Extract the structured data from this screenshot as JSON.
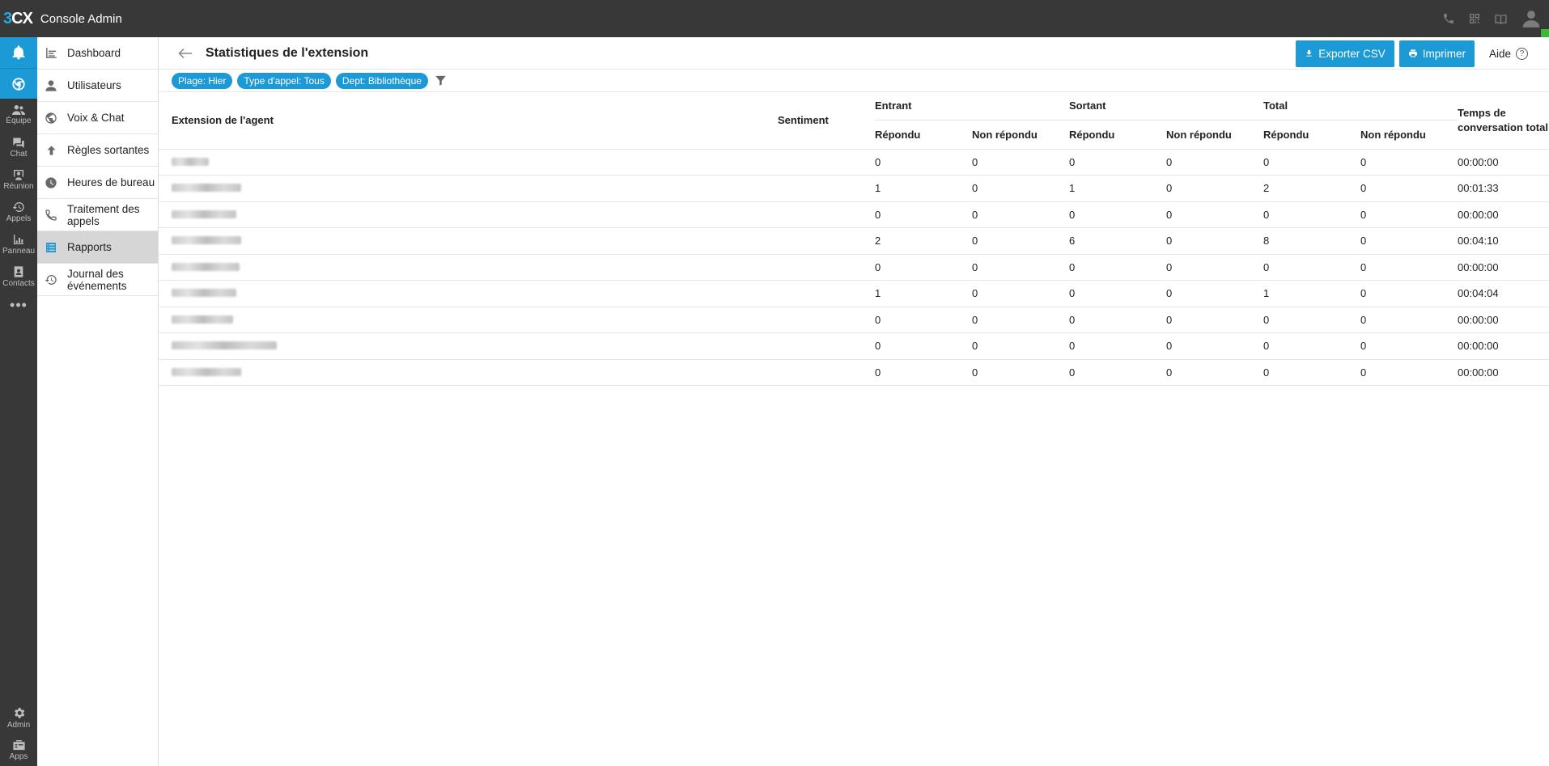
{
  "app": {
    "logo_accent": "3",
    "logo_rest": "CX",
    "title": "Console Admin"
  },
  "rail": {
    "items": [
      {
        "label": "Équipe",
        "icon": "team-icon"
      },
      {
        "label": "Chat",
        "icon": "chat-icon"
      },
      {
        "label": "Réunion",
        "icon": "meeting-icon"
      },
      {
        "label": "Appels",
        "icon": "calls-history-icon"
      },
      {
        "label": "Panneau",
        "icon": "panel-icon"
      },
      {
        "label": "Contacts",
        "icon": "contacts-icon"
      }
    ],
    "more": "•••",
    "bottom": [
      {
        "label": "Admin",
        "icon": "gear-icon"
      },
      {
        "label": "Apps",
        "icon": "apps-icon"
      }
    ]
  },
  "sidebar": {
    "items": [
      {
        "label": "Dashboard",
        "icon": "dashboard-icon"
      },
      {
        "label": "Utilisateurs",
        "icon": "user-icon"
      },
      {
        "label": "Voix & Chat",
        "icon": "globe-icon"
      },
      {
        "label": "Règles sortantes",
        "icon": "arrow-up-icon"
      },
      {
        "label": "Heures de bureau",
        "icon": "clock-icon"
      },
      {
        "label": "Traitement des appels",
        "icon": "phone-icon"
      },
      {
        "label": "Rapports",
        "icon": "reports-icon",
        "active": true
      },
      {
        "label": "Journal des événements",
        "icon": "history-icon"
      }
    ]
  },
  "header": {
    "title": "Statistiques de l'extension",
    "export_label": "Exporter CSV",
    "print_label": "Imprimer",
    "help_label": "Aide",
    "help_glyph": "?"
  },
  "filters": [
    "Plage: Hier",
    "Type d'appel: Tous",
    "Dept: Bibliothèque"
  ],
  "table": {
    "col_agent": "Extension de l'agent",
    "col_sentiment": "Sentiment",
    "group_in": "Entrant",
    "group_out": "Sortant",
    "group_total": "Total",
    "col_talk": "Temps de conversation total",
    "sub_answered": "Répondu",
    "sub_unanswered": "Non répondu",
    "rows": [
      {
        "in_ans": "0",
        "in_un": "0",
        "out_ans": "0",
        "out_un": "0",
        "tot_ans": "0",
        "tot_un": "0",
        "talk": "00:00:00"
      },
      {
        "in_ans": "1",
        "in_un": "0",
        "out_ans": "1",
        "out_un": "0",
        "tot_ans": "2",
        "tot_un": "0",
        "talk": "00:01:33"
      },
      {
        "in_ans": "0",
        "in_un": "0",
        "out_ans": "0",
        "out_un": "0",
        "tot_ans": "0",
        "tot_un": "0",
        "talk": "00:00:00"
      },
      {
        "in_ans": "2",
        "in_un": "0",
        "out_ans": "6",
        "out_un": "0",
        "tot_ans": "8",
        "tot_un": "0",
        "talk": "00:04:10"
      },
      {
        "in_ans": "0",
        "in_un": "0",
        "out_ans": "0",
        "out_un": "0",
        "tot_ans": "0",
        "tot_un": "0",
        "talk": "00:00:00"
      },
      {
        "in_ans": "1",
        "in_un": "0",
        "out_ans": "0",
        "out_un": "0",
        "tot_ans": "1",
        "tot_un": "0",
        "talk": "00:04:04"
      },
      {
        "in_ans": "0",
        "in_un": "0",
        "out_ans": "0",
        "out_un": "0",
        "tot_ans": "0",
        "tot_un": "0",
        "talk": "00:00:00"
      },
      {
        "in_ans": "0",
        "in_un": "0",
        "out_ans": "0",
        "out_un": "0",
        "tot_ans": "0",
        "tot_un": "0",
        "talk": "00:00:00"
      },
      {
        "in_ans": "0",
        "in_un": "0",
        "out_ans": "0",
        "out_un": "0",
        "tot_ans": "0",
        "tot_un": "0",
        "talk": "00:00:00"
      }
    ]
  },
  "colors": {
    "accent": "#1b9ad6",
    "topbar": "#383838",
    "active_bg": "#d6d6d6",
    "online": "#3cb73c"
  }
}
